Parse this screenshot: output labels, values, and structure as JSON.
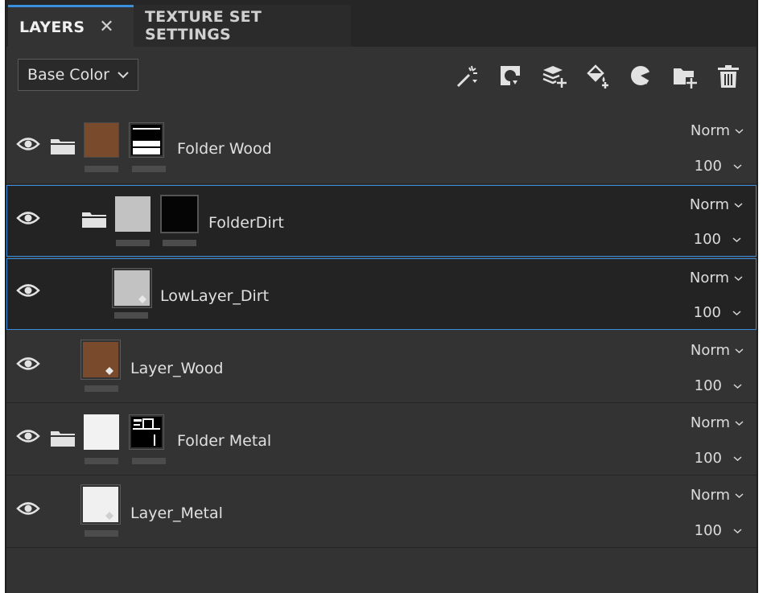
{
  "tabs": [
    {
      "label": "LAYERS",
      "active": true,
      "close_icon": "close-icon"
    },
    {
      "label": "TEXTURE SET SETTINGS",
      "active": false
    }
  ],
  "toolbar": {
    "channel": "Base Color",
    "tools": [
      "magic-wand-icon",
      "add-mask-icon",
      "add-layer-icon",
      "add-fill-layer-icon",
      "add-effect-icon",
      "add-folder-icon",
      "delete-icon"
    ]
  },
  "layers": [
    {
      "name": "Folder Wood",
      "type": "folder",
      "blend": "Norm",
      "opacity": "100",
      "selected": false
    },
    {
      "name": "FolderDirt",
      "type": "folder",
      "blend": "Norm",
      "opacity": "100",
      "selected": true
    },
    {
      "name": "LowLayer_Dirt",
      "type": "fill",
      "blend": "Norm",
      "opacity": "100",
      "selected": true
    },
    {
      "name": "Layer_Wood",
      "type": "fill",
      "blend": "Norm",
      "opacity": "100",
      "selected": false
    },
    {
      "name": "Folder Metal",
      "type": "folder",
      "blend": "Norm",
      "opacity": "100",
      "selected": false
    },
    {
      "name": "Layer_Metal",
      "type": "fill",
      "blend": "Norm",
      "opacity": "100",
      "selected": false
    }
  ],
  "colors": {
    "accent": "#3a8edb",
    "panel": "#333333",
    "wood": "#7a4a2c"
  }
}
